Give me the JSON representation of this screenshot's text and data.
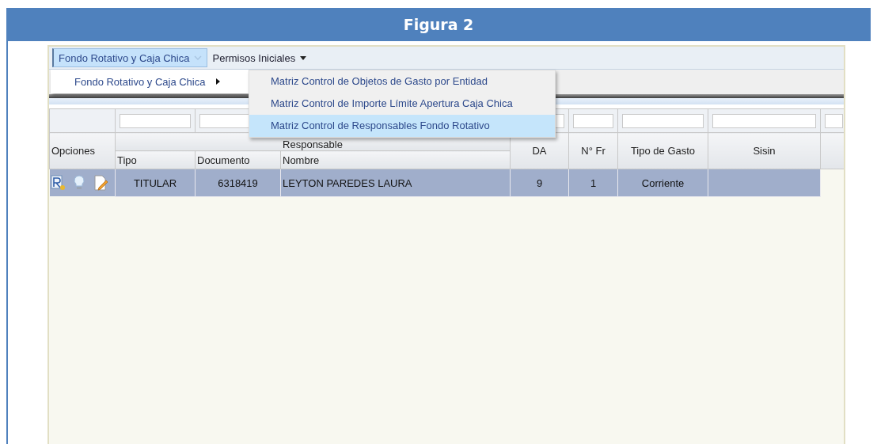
{
  "title": "Figura 2",
  "menubar": [
    {
      "label": "Fondo Rotativo y Caja Chica",
      "selected": true,
      "kind": "chevron"
    },
    {
      "label": "Permisos Iniciales",
      "selected": false,
      "kind": "caret"
    }
  ],
  "menu": [
    {
      "label": "Fondo Rotativo y Caja Chica",
      "has_submenu": true
    }
  ],
  "submenu": [
    {
      "label": "Matriz Control de Objetos de Gasto por Entidad",
      "selected": false
    },
    {
      "label": "Matriz Control de Importe Límite Apertura Caja Chica",
      "selected": false
    },
    {
      "label": "Matriz Control de Responsables Fondo Rotativo",
      "selected": true
    }
  ],
  "grid": {
    "group_header": "Responsable",
    "columns": [
      {
        "header": "Opciones",
        "grouped": false,
        "filter": false
      },
      {
        "header": "Tipo",
        "grouped": true,
        "filter": true
      },
      {
        "header": "Documento",
        "grouped": true,
        "filter": true
      },
      {
        "header": "Nombre",
        "grouped": true,
        "filter": false
      },
      {
        "header": "DA",
        "grouped": false,
        "filter": true
      },
      {
        "header": "N° Fr",
        "grouped": false,
        "filter": true
      },
      {
        "header": "Tipo de Gasto",
        "grouped": false,
        "filter": true
      },
      {
        "header": "Sisin",
        "grouped": false,
        "filter": true
      },
      {
        "grouped": false,
        "filter": true
      }
    ],
    "rows": [
      {
        "selected": true,
        "cells": [
          "",
          "TITULAR",
          "6318419",
          "LEYTON PAREDES LAURA",
          "9",
          "1",
          "Corriente",
          ""
        ]
      }
    ]
  }
}
